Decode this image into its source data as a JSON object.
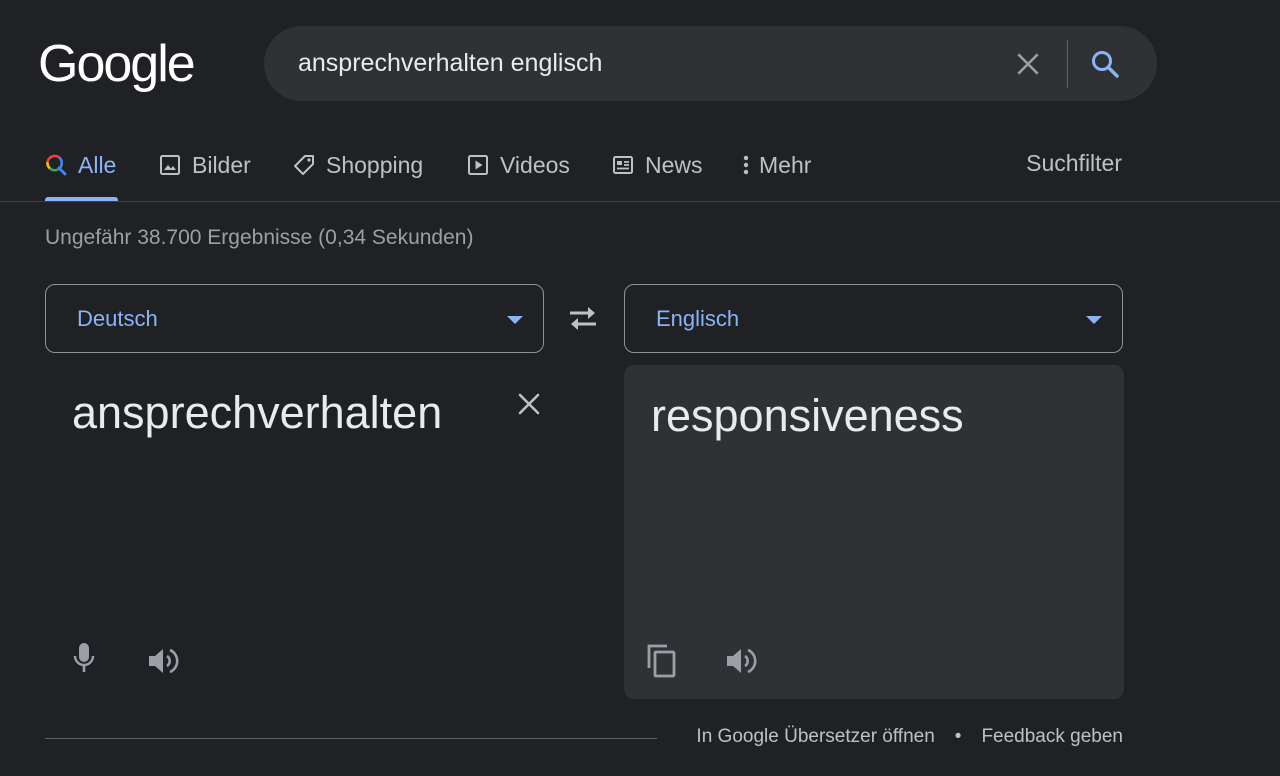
{
  "logo": {
    "text": "Google"
  },
  "search": {
    "query": "ansprechverhalten englisch"
  },
  "tabs": [
    {
      "label": "Alle",
      "icon": "search-icon"
    },
    {
      "label": "Bilder",
      "icon": "image-icon"
    },
    {
      "label": "Shopping",
      "icon": "tag-icon"
    },
    {
      "label": "Videos",
      "icon": "play-icon"
    },
    {
      "label": "News",
      "icon": "newspaper-icon"
    },
    {
      "label": "Mehr",
      "icon": "more-vert-icon"
    }
  ],
  "tools_label": "Suchfilter",
  "result_stats": "Ungefähr 38.700 Ergebnisse (0,34 Sekunden)",
  "translate": {
    "source_lang": "Deutsch",
    "target_lang": "Englisch",
    "source_text": "ansprechverhalten",
    "target_text": "responsiveness"
  },
  "footer": {
    "open_translate": "In Google Übersetzer öffnen",
    "separator": "•",
    "feedback": "Feedback geben"
  },
  "colors": {
    "background": "#202124",
    "surface": "#303134",
    "accent": "#8ab4f8",
    "text": "#e8eaed",
    "muted": "#bdc1c6"
  }
}
